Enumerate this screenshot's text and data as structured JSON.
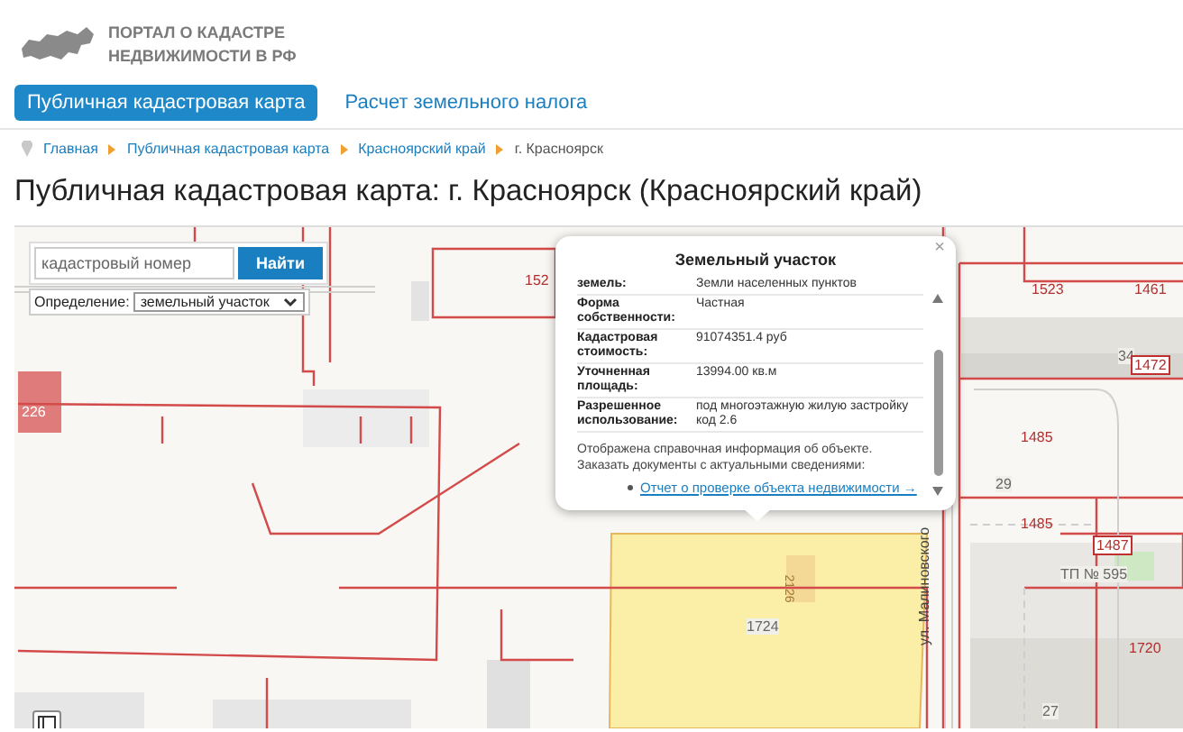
{
  "header": {
    "logo_lines": [
      "ПОРТАЛ О КАДАСТРЕ",
      "НЕДВИЖИМОСТИ В РФ"
    ]
  },
  "nav": [
    {
      "label": "Публичная кадастровая карта",
      "selected": true
    },
    {
      "label": "Расчет земельного налога",
      "selected": false
    }
  ],
  "breadcrumb": [
    "Главная",
    "Публичная кадастровая карта",
    "Красноярский край",
    "г. Красноярск"
  ],
  "title": "Публичная кадастровая карта: г. Красноярск (Красноярский край)",
  "map": {
    "search": {
      "placeholder": "кадастровый номер",
      "button": "Найти"
    },
    "definition": {
      "label": "Определение:",
      "value": "земельный участок"
    },
    "labels": [
      {
        "text": "152",
        "kind": "parcel"
      },
      {
        "text": "1523",
        "kind": "parcel"
      },
      {
        "text": "1461",
        "kind": "parcel"
      },
      {
        "text": "34",
        "kind": "plain"
      },
      {
        "text": "1472",
        "kind": "boxed"
      },
      {
        "text": "1485",
        "kind": "parcel"
      },
      {
        "text": "29",
        "kind": "plain"
      },
      {
        "text": "1485",
        "kind": "parcel"
      },
      {
        "text": "1487",
        "kind": "boxed"
      },
      {
        "text": "ТП № 595",
        "kind": "plain"
      },
      {
        "text": "1720",
        "kind": "parcel"
      },
      {
        "text": "27",
        "kind": "plain"
      },
      {
        "text": "1724",
        "kind": "plain"
      },
      {
        "text": "2126",
        "kind": "vertical"
      },
      {
        "text": "226",
        "kind": "light"
      },
      {
        "text": "ул. Малиновского",
        "kind": "street"
      }
    ],
    "popup": {
      "title": "Земельный участок",
      "close": "×",
      "rows": [
        {
          "label": "земель:",
          "value": "Земли населенных пунктов"
        },
        {
          "label": "Форма собственности:",
          "value": "Частная"
        },
        {
          "label": "Кадастровая стоимость:",
          "value": "91074351.4 руб"
        },
        {
          "label": "Уточненная площадь:",
          "value": "13994.00 кв.м"
        },
        {
          "label": "Разрешенное использование:",
          "value": "под многоэтажную жилую застройку код 2.6"
        }
      ],
      "note": "Отображена справочная информация об объекте. Заказать документы с актуальными сведениями:",
      "link": "Отчет о проверке объекта недвижимости →"
    }
  }
}
